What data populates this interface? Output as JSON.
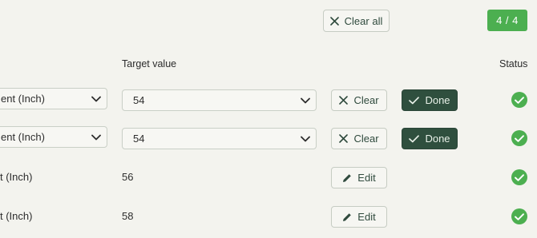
{
  "toolbar": {
    "clear_all_label": "Clear all",
    "counter": "4 / 4"
  },
  "headers": {
    "target_value": "Target value",
    "status": "Status"
  },
  "rows": [
    {
      "unit": "ent (Inch)",
      "target": "54",
      "action": "Clear",
      "done": "Done",
      "status": "check-icon"
    },
    {
      "unit": "ent (Inch)",
      "target": "54",
      "action": "Clear",
      "done": "Done",
      "status": "check-icon"
    },
    {
      "unit": "t (Inch)",
      "target": "56",
      "action": "Edit",
      "status": "check-icon"
    },
    {
      "unit": "t (Inch)",
      "target": "58",
      "action": "Edit",
      "status": "check-icon"
    }
  ],
  "colors": {
    "accent_green": "#4caf50",
    "done_button": "#2f4f3e",
    "background": "#f3f3ee"
  }
}
